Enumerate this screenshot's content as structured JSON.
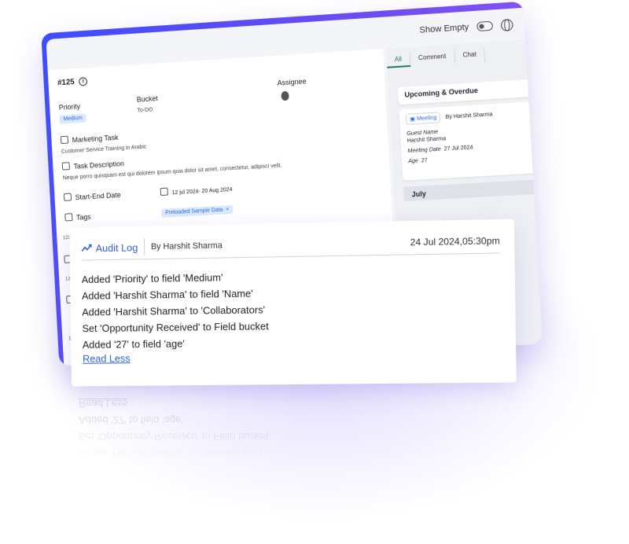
{
  "topbar": {
    "show_empty_label": "Show Empty"
  },
  "task": {
    "id": "#125",
    "priority_label": "Priority",
    "priority_value": "Medium",
    "bucket_label": "Bucket",
    "bucket_value": "To-DO",
    "assignee_label": "Assignee",
    "task_type_label": "Marketing Task",
    "task_type_value": "Customer Service Training in Arabic",
    "description_label": "Task Description",
    "description_value": "Neque porro quisquam est qui dolorem ipsum quia dolor sit amet, consectetur, adipisci velit.",
    "dates_label": "Start-End Date",
    "dates_value": "12 jul 2024- 20 Aug 2024",
    "tags_label": "Tags",
    "tag_value": "Preloaded Sample Data",
    "tag_remove": "×"
  },
  "right_panel": {
    "tabs": [
      "All",
      "Comment",
      "Chat"
    ],
    "upcoming_title": "Upcoming & Overdue",
    "meeting_tag": "Meeting",
    "meeting_by": "By Harshit Sharma",
    "guest_name_label": "Guest Name",
    "guest_name_value": "Harshit Sharma",
    "meeting_date_label": "Meeting Date",
    "meeting_date_value": "27 Jul 2024",
    "age_label": "Age",
    "age_value": "27",
    "month": "July"
  },
  "audit": {
    "title": "Audit Log",
    "by": "By Harshit Sharma",
    "date": "24 Jul 2024,05:30pm",
    "lines": [
      "Added 'Priority' to field 'Medium'",
      "Added 'Harshit Sharma' to field 'Name'",
      "Added 'Harshit Sharma' to 'Collaborators'",
      "Set 'Opportunity Received' to Field bucket",
      "Added '27' to field 'age'"
    ],
    "read_less": "Read Less"
  }
}
